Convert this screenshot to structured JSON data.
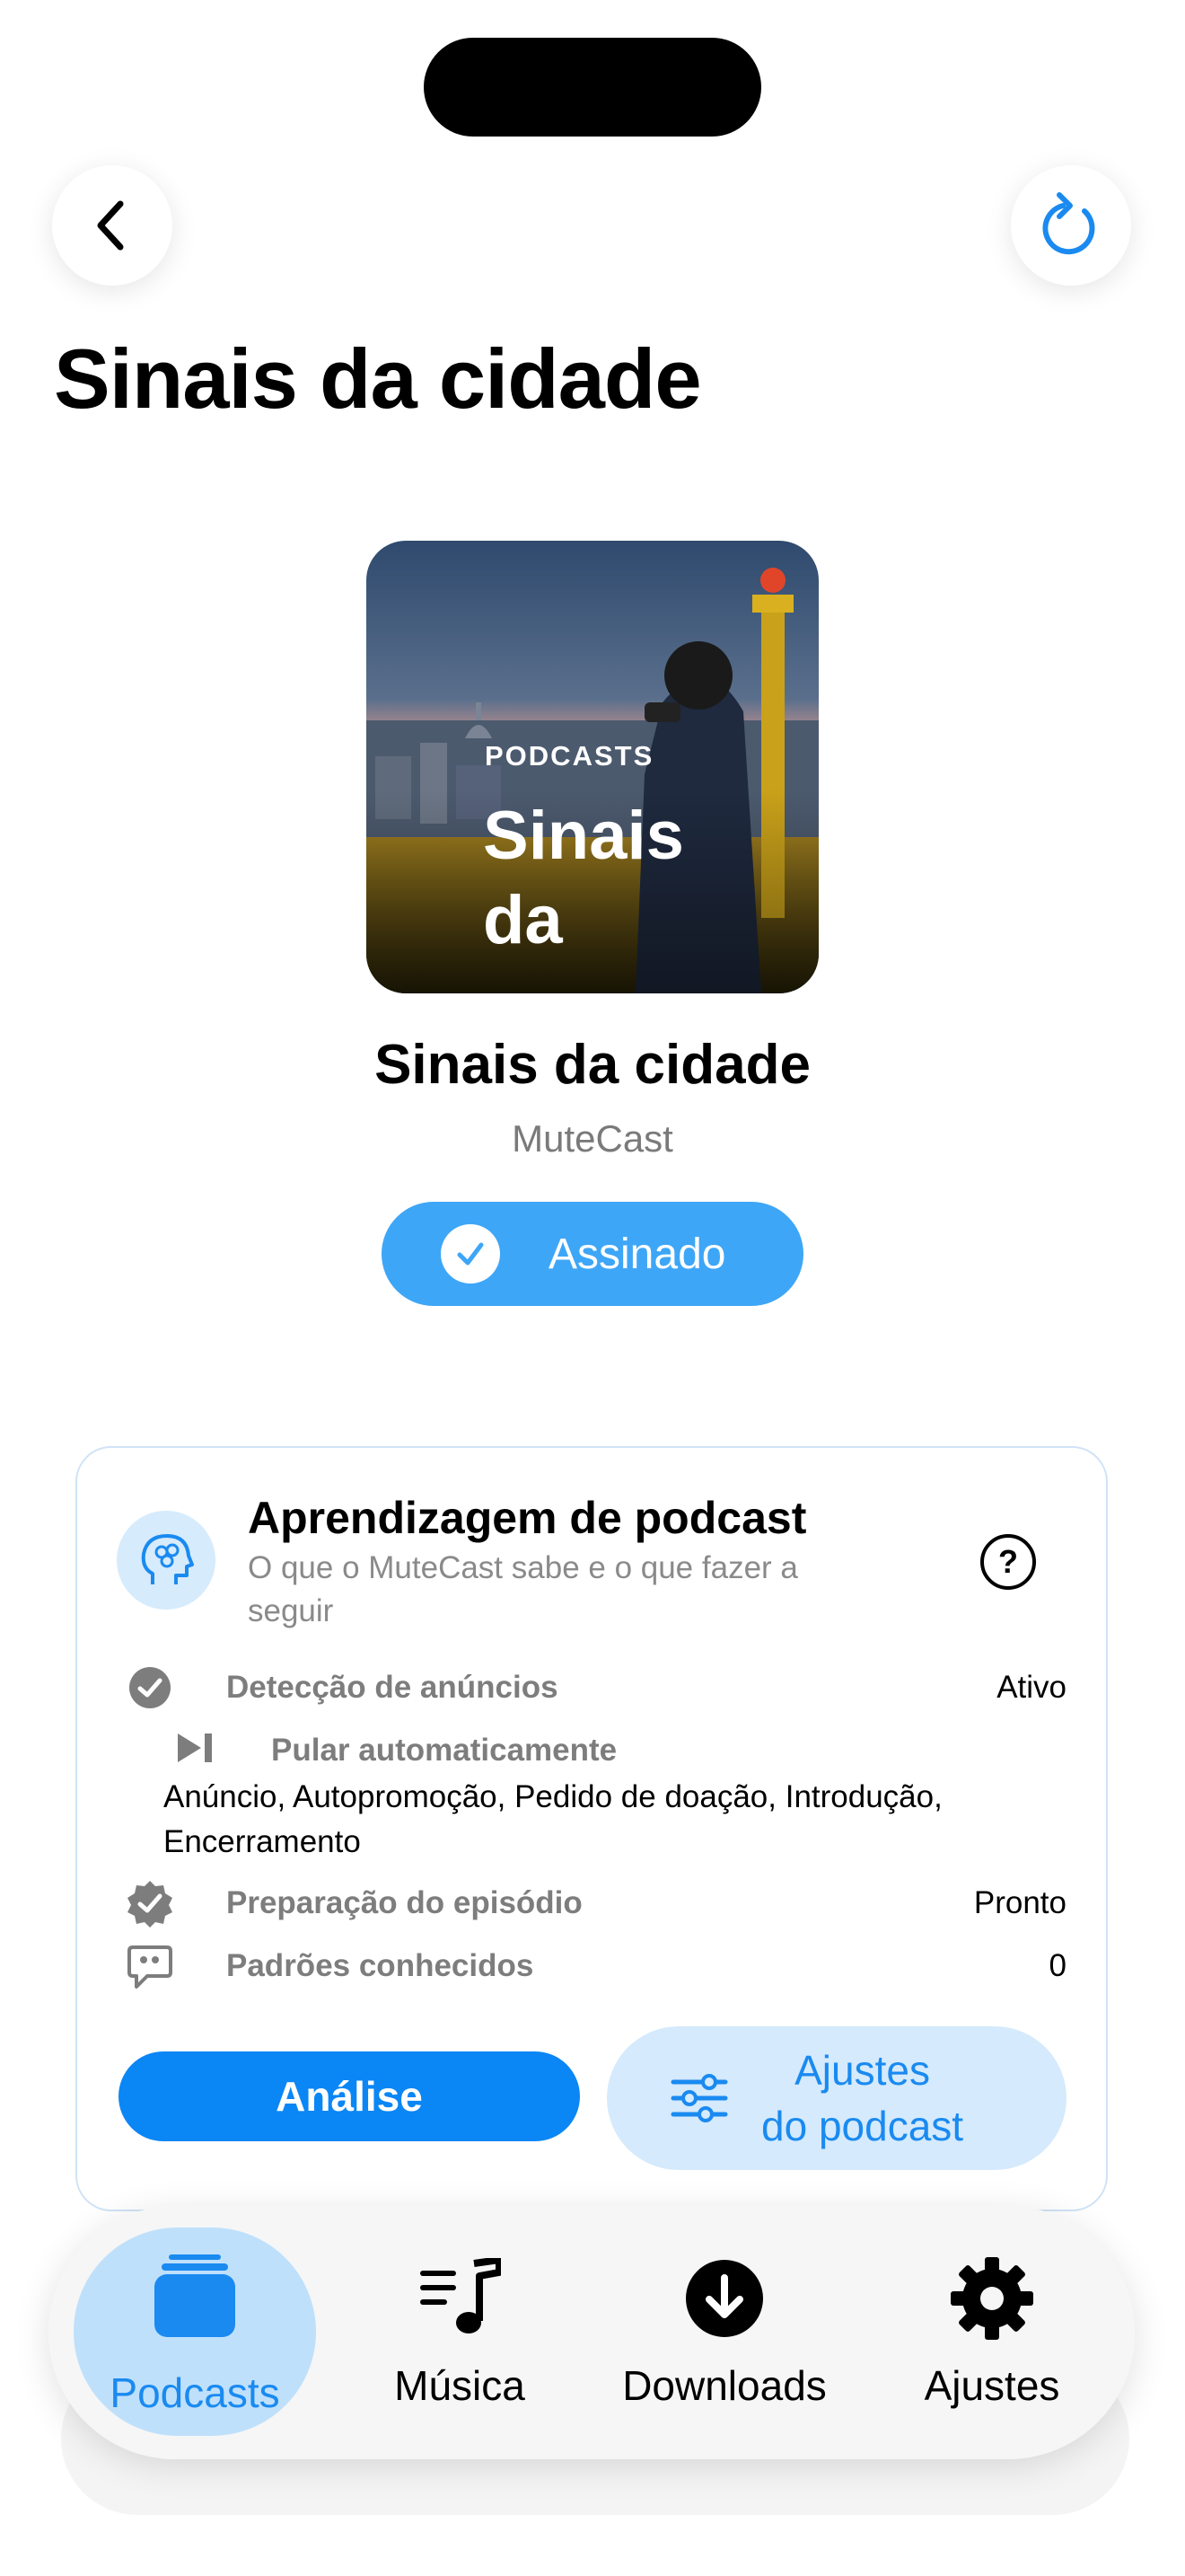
{
  "header": {
    "title": "Sinais da cidade"
  },
  "cover": {
    "label": "PODCASTS",
    "title_lines": [
      "Sinais",
      "da"
    ]
  },
  "podcast": {
    "title": "Sinais da cidade",
    "author": "MuteCast",
    "subscribe_label": "Assinado"
  },
  "learning_card": {
    "title": "Aprendizagem de podcast",
    "subtitle": "O que o MuteCast sabe e o que fazer a seguir",
    "rows": [
      {
        "icon": "check-circle-icon",
        "label": "Detecção de anúncios",
        "value": "Ativo"
      },
      {
        "icon": "skip-forward-icon",
        "label": "Pular automaticamente",
        "value": ""
      },
      {
        "icon": "seal-check-icon",
        "label": "Preparação do episódio",
        "value": "Pronto"
      },
      {
        "icon": "quote-bubble-icon",
        "label": "Padrões conhecidos",
        "value": "0"
      }
    ],
    "skip_list": "Anúncio, Autopromoção, Pedido de doação, Introdução, Encerramento",
    "analysis_button": "Análise",
    "settings_button_lines": [
      "Ajustes",
      "do podcast"
    ]
  },
  "tab_bar": {
    "items": [
      {
        "label": "Podcasts",
        "icon": "stack-icon",
        "active": true
      },
      {
        "label": "Música",
        "icon": "music-list-icon",
        "active": false
      },
      {
        "label": "Downloads",
        "icon": "download-circle-icon",
        "active": false
      },
      {
        "label": "Ajustes",
        "icon": "gear-icon",
        "active": false
      }
    ]
  },
  "colors": {
    "accent": "#0b86f5",
    "subscribe": "#3ea6f7",
    "accent_light": "#d5eafc",
    "muted_text": "#7d7d7d"
  }
}
